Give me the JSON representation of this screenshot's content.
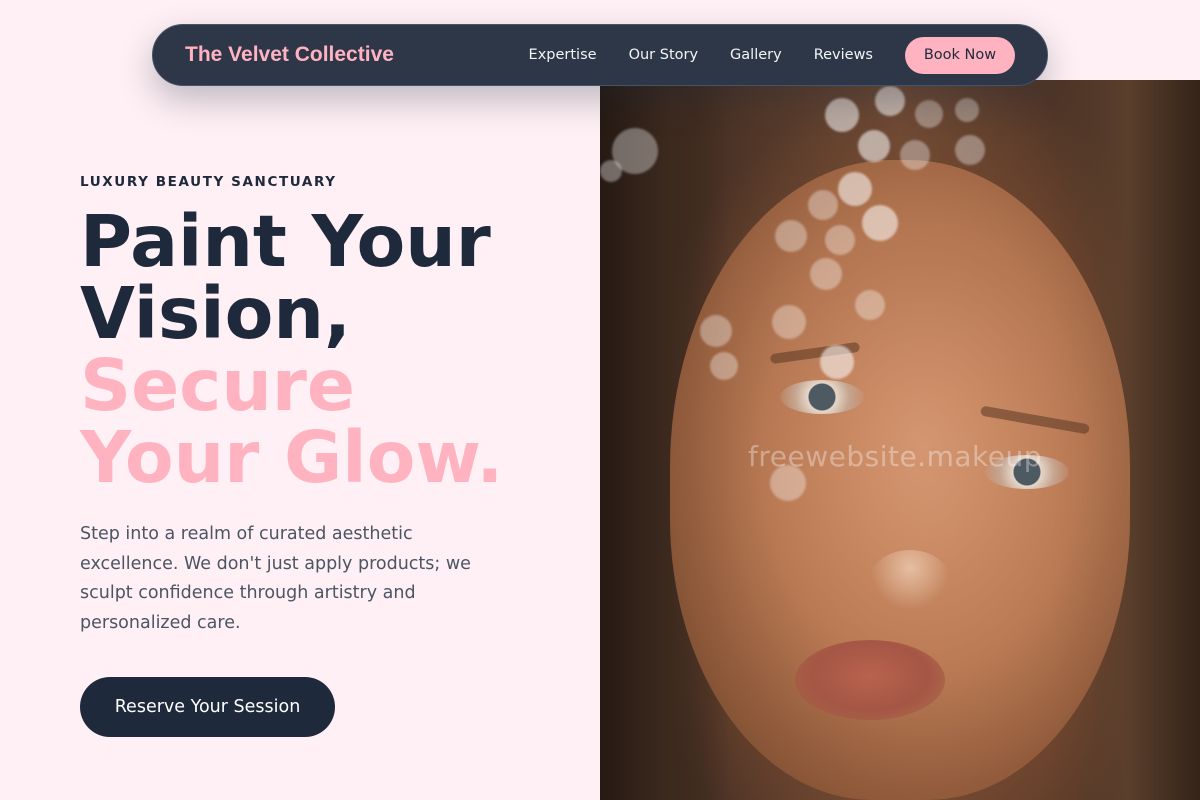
{
  "nav": {
    "brand": "The Velvet Collective",
    "links": [
      "Expertise",
      "Our Story",
      "Gallery",
      "Reviews"
    ],
    "cta_label": "Book Now"
  },
  "hero": {
    "eyebrow": "LUXURY BEAUTY SANCTUARY",
    "headline_lines": [
      "Paint Your",
      "Vision,"
    ],
    "headline_accent_lines": [
      "Secure",
      "Your Glow."
    ],
    "description": "Step into a realm of curated aesthetic excellence. We don't just apply products; we sculpt confidence through artistry and personalized care.",
    "cta_label": "Reserve Your Session",
    "image_watermark": "freewebsite.makeup"
  },
  "colors": {
    "background": "#fff0f5",
    "navbar": "#2d3748",
    "accent_pink": "#ffb3c1",
    "dark_navy": "#1e293b",
    "body_text": "#4b5563"
  }
}
